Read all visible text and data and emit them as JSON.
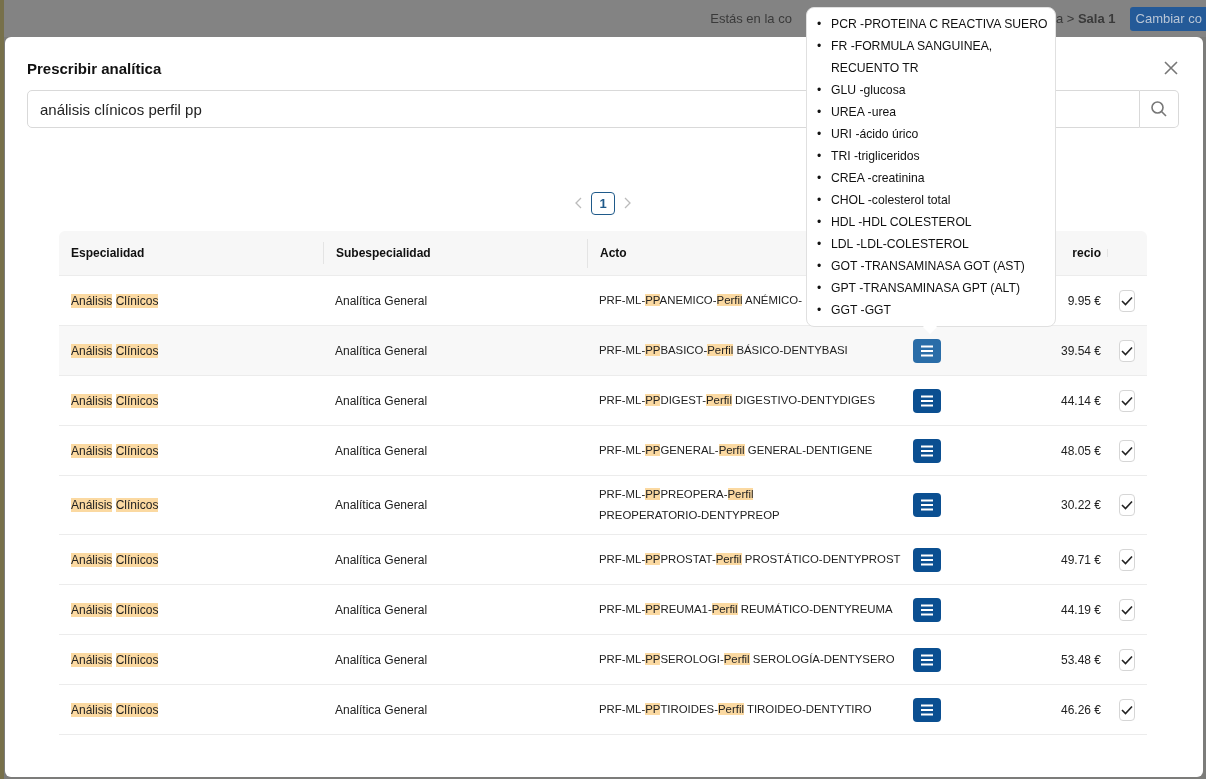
{
  "top_bar": {
    "location_start": "Estás en la co",
    "location_end": "a > **Sala 1**",
    "button": "Cambiar co"
  },
  "dialog": {
    "title": "Prescribir analítica",
    "search": {
      "value": "análisis clínicos perfil pp"
    },
    "pagination": {
      "pages": [
        {
          "label": "1",
          "selected": true
        }
      ]
    },
    "table": {
      "columns": [
        "Especialidad",
        "Subespecialidad",
        "Acto",
        "recio"
      ],
      "rows": [
        {
          "especialidad": [
            [
              {
                "text": "Análisis",
                "highlighted": true
              }
            ],
            [
              {
                "text": "Clínicos",
                "highlighted": true
              }
            ]
          ],
          "subespecialidad": "Analítica General",
          "acto": [
            [
              {
                "text": "PRF-ML-",
                "highlighted": false
              },
              {
                "text": "PP",
                "highlighted": true
              },
              {
                "text": "ANEMICO-",
                "highlighted": false
              },
              {
                "text": "Perfil",
                "highlighted": true
              }
            ],
            [
              {
                "text": "ANÉMICO-",
                "highlighted": false
              }
            ]
          ],
          "precio": "9.95 €",
          "checked": true
        },
        {
          "especialidad": [
            [
              {
                "text": "Análisis",
                "highlighted": true
              }
            ],
            [
              {
                "text": "Clínicos",
                "highlighted": true
              }
            ]
          ],
          "subespecialidad": "Analítica General",
          "acto": [
            [
              {
                "text": "PRF-ML-",
                "highlighted": false
              },
              {
                "text": "PP",
                "highlighted": true
              },
              {
                "text": "BASICO-",
                "highlighted": false
              },
              {
                "text": "Perfil",
                "highlighted": true
              }
            ],
            [
              {
                "text": "BÁSICO-DENTYBASI",
                "highlighted": false
              }
            ]
          ],
          "details_button": {
            "active": true
          },
          "precio": "39.54 €",
          "checked": true
        },
        {
          "especialidad": [
            [
              {
                "text": "Análisis",
                "highlighted": true
              }
            ],
            [
              {
                "text": "Clínicos",
                "highlighted": true
              }
            ]
          ],
          "subespecialidad": "Analítica General",
          "acto": [
            [
              {
                "text": "PRF-ML-",
                "highlighted": false
              },
              {
                "text": "PP",
                "highlighted": true
              },
              {
                "text": "DIGEST-",
                "highlighted": false
              },
              {
                "text": "Perfil",
                "highlighted": true
              }
            ],
            [
              {
                "text": "DIGESTIVO-DENTYDIGES",
                "highlighted": false
              }
            ]
          ],
          "details_button": {
            "active": false
          },
          "precio": "44.14 €",
          "checked": true
        },
        {
          "especialidad": [
            [
              {
                "text": "Análisis",
                "highlighted": true
              }
            ],
            [
              {
                "text": "Clínicos",
                "highlighted": true
              }
            ]
          ],
          "subespecialidad": "Analítica General",
          "acto": [
            [
              {
                "text": "PRF-ML-",
                "highlighted": false
              },
              {
                "text": "PP",
                "highlighted": true
              },
              {
                "text": "GENERAL-",
                "highlighted": false
              },
              {
                "text": "Perfil",
                "highlighted": true
              }
            ],
            [
              {
                "text": "GENERAL-DENTIGENE",
                "highlighted": false
              }
            ]
          ],
          "details_button": {
            "active": false
          },
          "precio": "48.05 €",
          "checked": true
        },
        {
          "especialidad": [
            [
              {
                "text": "Análisis",
                "highlighted": true
              }
            ],
            [
              {
                "text": "Clínicos",
                "highlighted": true
              }
            ]
          ],
          "subespecialidad": "Analítica General",
          "acto": [
            [
              {
                "text": "PRF-ML-",
                "highlighted": false
              },
              {
                "text": "PP",
                "highlighted": true
              },
              {
                "text": "PREOPERA-",
                "highlighted": false
              },
              {
                "text": "Perfil",
                "highlighted": true
              }
            ],
            [
              {
                "text": "PREOPERATORIO-DENTYPREOP",
                "highlighted": false
              }
            ]
          ],
          "details_button": {
            "active": false
          },
          "precio": "30.22 €",
          "checked": true
        },
        {
          "especialidad": [
            [
              {
                "text": "Análisis",
                "highlighted": true
              }
            ],
            [
              {
                "text": "Clínicos",
                "highlighted": true
              }
            ]
          ],
          "subespecialidad": "Analítica General",
          "acto": [
            [
              {
                "text": "PRF-ML-",
                "highlighted": false
              },
              {
                "text": "PP",
                "highlighted": true
              },
              {
                "text": "PROSTAT-",
                "highlighted": false
              },
              {
                "text": "Perfil",
                "highlighted": true
              }
            ],
            [
              {
                "text": "PROSTÁTICO-DENTYPROST",
                "highlighted": false
              }
            ]
          ],
          "details_button": {
            "active": false
          },
          "precio": "49.71 €",
          "checked": true
        },
        {
          "especialidad": [
            [
              {
                "text": "Análisis",
                "highlighted": true
              }
            ],
            [
              {
                "text": "Clínicos",
                "highlighted": true
              }
            ]
          ],
          "subespecialidad": "Analítica General",
          "acto": [
            [
              {
                "text": "PRF-ML-",
                "highlighted": false
              },
              {
                "text": "PP",
                "highlighted": true
              },
              {
                "text": "REUMA1-",
                "highlighted": false
              },
              {
                "text": "Perfil",
                "highlighted": true
              }
            ],
            [
              {
                "text": "REUMÁTICO-DENTYREUMA",
                "highlighted": false
              }
            ]
          ],
          "details_button": {
            "active": false
          },
          "precio": "44.19 €",
          "checked": true
        },
        {
          "especialidad": [
            [
              {
                "text": "Análisis",
                "highlighted": true
              }
            ],
            [
              {
                "text": "Clínicos",
                "highlighted": true
              }
            ]
          ],
          "subespecialidad": "Analítica General",
          "acto": [
            [
              {
                "text": "PRF-ML-",
                "highlighted": false
              },
              {
                "text": "PP",
                "highlighted": true
              },
              {
                "text": "SEROLOGI-",
                "highlighted": false
              },
              {
                "text": "Perfil",
                "highlighted": true
              }
            ],
            [
              {
                "text": "SEROLOGÍA-DENTYSERO",
                "highlighted": false
              }
            ]
          ],
          "details_button": {
            "active": false
          },
          "precio": "53.48 €",
          "checked": true
        },
        {
          "especialidad": [
            [
              {
                "text": "Análisis",
                "highlighted": true
              }
            ],
            [
              {
                "text": "Clínicos",
                "highlighted": true
              }
            ]
          ],
          "subespecialidad": "Analítica General",
          "acto": [
            [
              {
                "text": "PRF-ML-",
                "highlighted": false
              },
              {
                "text": "PP",
                "highlighted": true
              },
              {
                "text": "TIROIDES-",
                "highlighted": false
              },
              {
                "text": "Perfil",
                "highlighted": true
              }
            ],
            [
              {
                "text": "TIROIDEO-DENTYTIRO",
                "highlighted": false
              }
            ]
          ],
          "details_button": {
            "active": false
          },
          "precio": "46.26 €",
          "checked": true
        }
      ]
    }
  },
  "tooltip": {
    "items": [
      {
        "bullet": "•",
        "text": "PCR -PROTEINA C REACTIVA SUERO"
      },
      {
        "bullet": "•",
        "text": "FR -FORMULA SANGUINEA, RECUENTO TR"
      },
      {
        "bullet": "•",
        "text": "GLU -glucosa"
      },
      {
        "bullet": "•",
        "text": "UREA -urea"
      },
      {
        "bullet": "•",
        "text": "URI -ácido úrico"
      },
      {
        "bullet": "•",
        "text": "TRI -trigliceridos"
      },
      {
        "bullet": "•",
        "text": "CREA -creatinina"
      },
      {
        "bullet": "•",
        "text": "CHOL -colesterol total"
      },
      {
        "bullet": "•",
        "text": "HDL -HDL COLESTEROL"
      },
      {
        "bullet": "•",
        "text": "LDL -LDL-COLESTEROL"
      },
      {
        "bullet": "•",
        "text": "GOT -TRANSAMINASA GOT (AST)"
      },
      {
        "bullet": "•",
        "text": "GPT -TRANSAMINASA GPT (ALT)"
      },
      {
        "bullet": "•",
        "text": "GGT -GGT"
      }
    ]
  }
}
